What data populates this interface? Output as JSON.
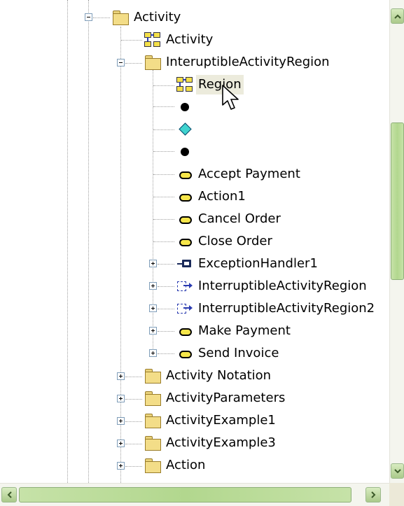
{
  "tree": {
    "root": {
      "label": "Activity",
      "icon": "folder-icon",
      "expanded": true
    },
    "activity_diagram": {
      "label": "Activity",
      "icon": "activity-diagram-icon"
    },
    "region_folder": {
      "label": "InteruptibleActivityRegion",
      "icon": "folder-icon",
      "expanded": true
    },
    "region_diagram": {
      "label": "Region",
      "icon": "activity-diagram-icon",
      "selected": true
    },
    "unnamed_nodes": [
      {
        "icon": "initial-node-icon"
      },
      {
        "icon": "decision-node-icon"
      },
      {
        "icon": "final-node-icon"
      }
    ],
    "actions": [
      {
        "label": "Accept Payment",
        "icon": "action-icon"
      },
      {
        "label": "Action1",
        "icon": "action-icon"
      },
      {
        "label": "Cancel Order",
        "icon": "action-icon"
      },
      {
        "label": "Close Order",
        "icon": "action-icon"
      }
    ],
    "expandable_children": [
      {
        "label": "ExceptionHandler1",
        "icon": "exception-handler-icon"
      },
      {
        "label": "InterruptibleActivityRegion",
        "icon": "interruptible-region-icon"
      },
      {
        "label": "InterruptibleActivityRegion2",
        "icon": "interruptible-region-icon"
      },
      {
        "label": "Make Payment",
        "icon": "action-icon"
      },
      {
        "label": "Send Invoice",
        "icon": "action-icon"
      }
    ],
    "sibling_folders": [
      {
        "label": "Activity Notation",
        "icon": "folder-icon"
      },
      {
        "label": "ActivityParameters",
        "icon": "folder-icon"
      },
      {
        "label": "ActivityExample1",
        "icon": "folder-icon"
      },
      {
        "label": "ActivityExample3",
        "icon": "folder-icon"
      },
      {
        "label": "Action",
        "icon": "folder-icon"
      }
    ]
  },
  "colors": {
    "selection": "#ecebdc",
    "scrollbar_thumb": "#b2d78e",
    "folder": "#f3dd88",
    "decision": "#3fd3cf"
  }
}
